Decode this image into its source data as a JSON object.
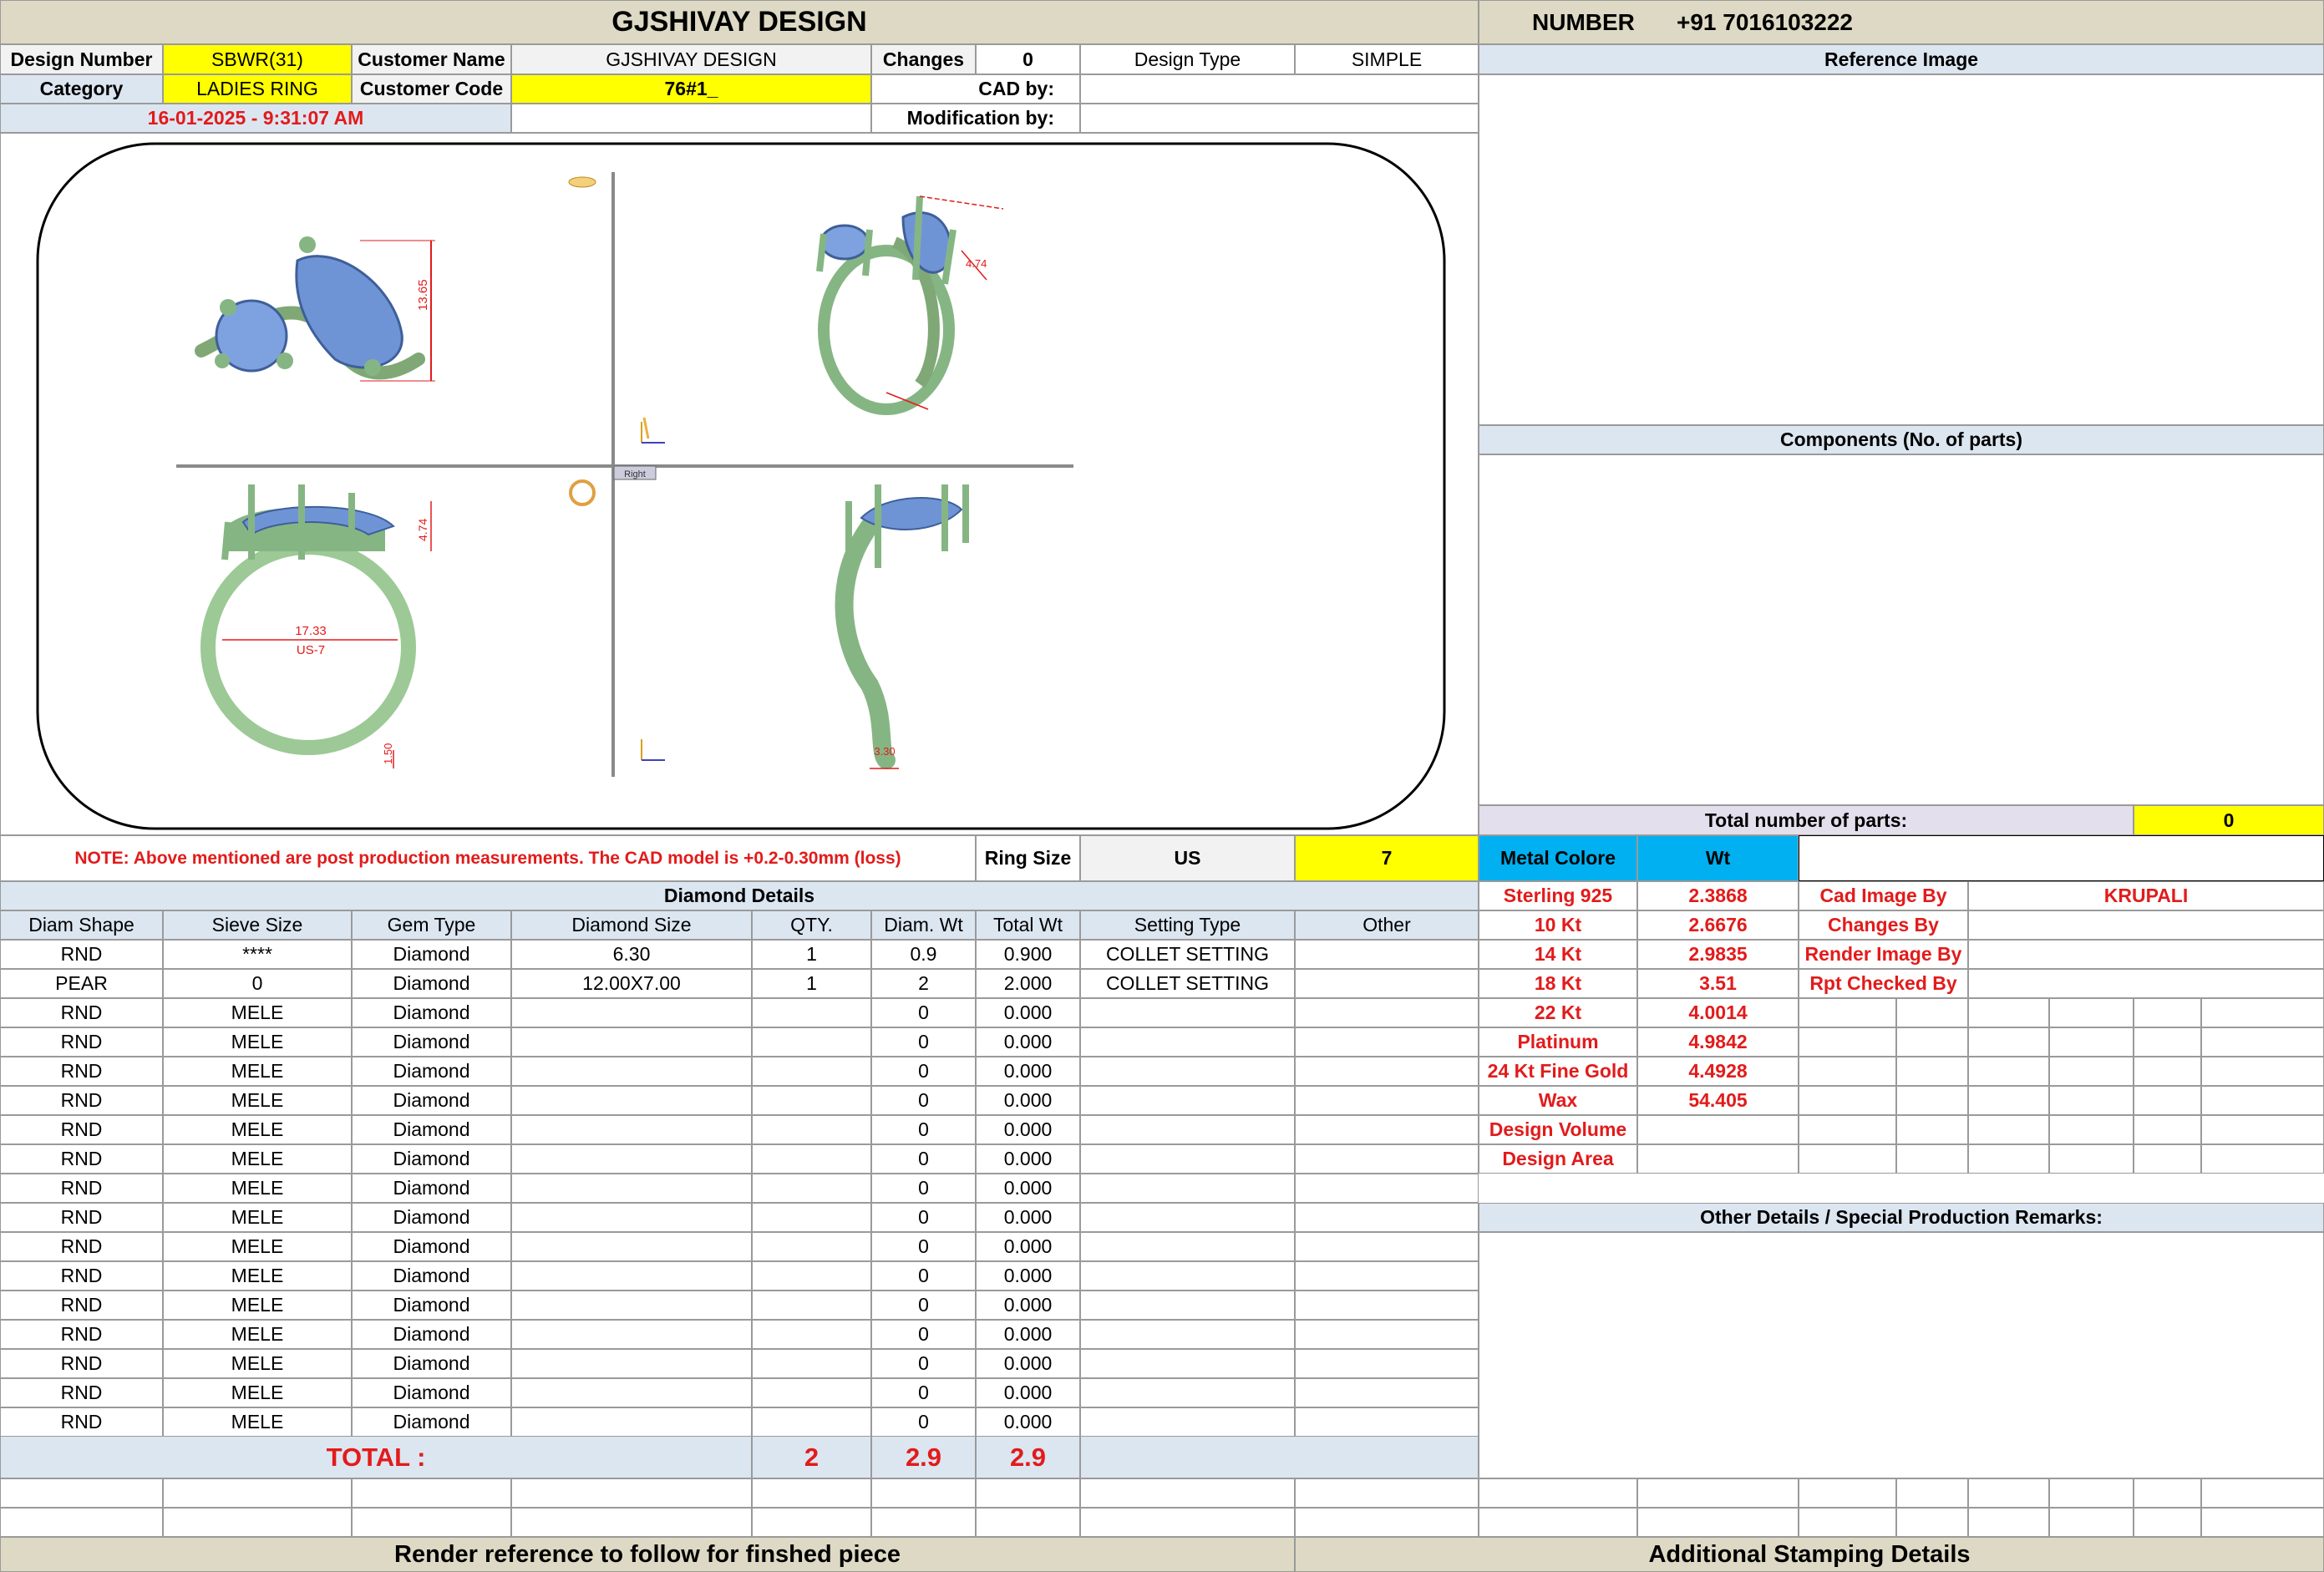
{
  "header": {
    "title": "GJSHIVAY DESIGN",
    "number_label": "NUMBER",
    "number_value": "+91 7016103222"
  },
  "info": {
    "design_number_label": "Design Number",
    "design_number": "SBWR(31)",
    "customer_name_label": "Customer Name",
    "customer_name": "GJSHIVAY DESIGN",
    "changes_label": "Changes",
    "changes": "0",
    "design_type_label": "Design Type",
    "design_type": "SIMPLE",
    "category_label": "Category",
    "category": "LADIES RING",
    "customer_code_label": "Customer Code",
    "customer_code": "76#1_",
    "cad_by_label": "CAD by:",
    "cad_by": "",
    "datetime": "16-01-2025 - 9:31:07 AM",
    "modification_label": "Modification by:",
    "modification": ""
  },
  "right_panel": {
    "reference_image": "Reference Image",
    "components": "Components (No. of parts)",
    "total_parts_label": "Total number of parts:",
    "total_parts": "0"
  },
  "cad_views": {
    "dim_height": "13.65",
    "dim_stone": "4.74",
    "dim_inner": "17.33",
    "ring_us": "US-7",
    "dim_shank": "1.50",
    "dim_band": "3.30",
    "view_label": "Right"
  },
  "note": {
    "text": "NOTE: Above mentioned are post production measurements. The CAD model is +0.2-0.30mm (loss)",
    "ring_size_label": "Ring Size",
    "ring_size_system": "US",
    "ring_size": "7"
  },
  "metal": {
    "metal_label": "Metal Colore",
    "wt_label": "Wt",
    "rows": [
      {
        "name": "Sterling 925",
        "wt": "2.3868"
      },
      {
        "name": "10 Kt",
        "wt": "2.6676"
      },
      {
        "name": "14 Kt",
        "wt": "2.9835"
      },
      {
        "name": "18 Kt",
        "wt": "3.51"
      },
      {
        "name": "22 Kt",
        "wt": "4.0014"
      },
      {
        "name": "Platinum",
        "wt": "4.9842"
      },
      {
        "name": "24 Kt Fine Gold",
        "wt": "4.4928"
      },
      {
        "name": "Wax",
        "wt": "54.405"
      },
      {
        "name": "Design Volume",
        "wt": ""
      },
      {
        "name": "Design Area",
        "wt": ""
      }
    ]
  },
  "credits": [
    {
      "label": "Cad Image By",
      "value": "KRUPALI"
    },
    {
      "label": "Changes By",
      "value": ""
    },
    {
      "label": "Render Image By",
      "value": ""
    },
    {
      "label": "Rpt Checked By",
      "value": ""
    }
  ],
  "other_details": "Other Details / Special Production Remarks:",
  "diamond": {
    "title": "Diamond Details",
    "columns": [
      "Diam Shape",
      "Sieve Size",
      "Gem Type",
      "Diamond Size",
      "QTY.",
      "Diam. Wt",
      "Total Wt",
      "Setting Type",
      "Other"
    ],
    "rows": [
      [
        "RND",
        "****",
        "Diamond",
        "6.30",
        "1",
        "0.9",
        "0.900",
        "COLLET SETTING",
        ""
      ],
      [
        "PEAR",
        "0",
        "Diamond",
        "12.00X7.00",
        "1",
        "2",
        "2.000",
        "COLLET SETTING",
        ""
      ],
      [
        "RND",
        "MELE",
        "Diamond",
        "",
        "",
        "0",
        "0.000",
        "",
        ""
      ],
      [
        "RND",
        "MELE",
        "Diamond",
        "",
        "",
        "0",
        "0.000",
        "",
        ""
      ],
      [
        "RND",
        "MELE",
        "Diamond",
        "",
        "",
        "0",
        "0.000",
        "",
        ""
      ],
      [
        "RND",
        "MELE",
        "Diamond",
        "",
        "",
        "0",
        "0.000",
        "",
        ""
      ],
      [
        "RND",
        "MELE",
        "Diamond",
        "",
        "",
        "0",
        "0.000",
        "",
        ""
      ],
      [
        "RND",
        "MELE",
        "Diamond",
        "",
        "",
        "0",
        "0.000",
        "",
        ""
      ],
      [
        "RND",
        "MELE",
        "Diamond",
        "",
        "",
        "0",
        "0.000",
        "",
        ""
      ],
      [
        "RND",
        "MELE",
        "Diamond",
        "",
        "",
        "0",
        "0.000",
        "",
        ""
      ],
      [
        "RND",
        "MELE",
        "Diamond",
        "",
        "",
        "0",
        "0.000",
        "",
        ""
      ],
      [
        "RND",
        "MELE",
        "Diamond",
        "",
        "",
        "0",
        "0.000",
        "",
        ""
      ],
      [
        "RND",
        "MELE",
        "Diamond",
        "",
        "",
        "0",
        "0.000",
        "",
        ""
      ],
      [
        "RND",
        "MELE",
        "Diamond",
        "",
        "",
        "0",
        "0.000",
        "",
        ""
      ],
      [
        "RND",
        "MELE",
        "Diamond",
        "",
        "",
        "0",
        "0.000",
        "",
        ""
      ],
      [
        "RND",
        "MELE",
        "Diamond",
        "",
        "",
        "0",
        "0.000",
        "",
        ""
      ],
      [
        "RND",
        "MELE",
        "Diamond",
        "",
        "",
        "0",
        "0.000",
        "",
        ""
      ]
    ],
    "total_label": "TOTAL :",
    "total_qty": "2",
    "total_diam_wt": "2.9",
    "total_wt": "2.9"
  },
  "footer": {
    "render_reference": "Render reference to follow for finshed piece",
    "stamping": "Additional Stamping Details"
  }
}
